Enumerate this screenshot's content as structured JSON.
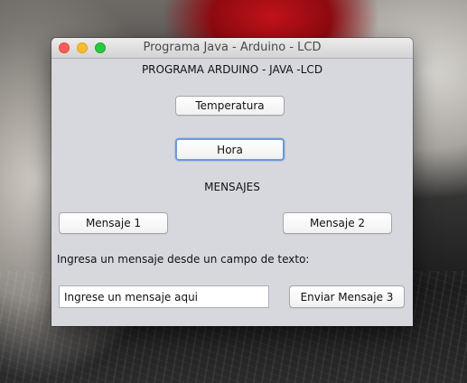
{
  "window": {
    "title": "Programa Java - Arduino - LCD"
  },
  "header": {
    "title": "PROGRAMA ARDUINO - JAVA -LCD"
  },
  "buttons": {
    "temperatura": "Temperatura",
    "hora": "Hora",
    "mensaje1": "Mensaje 1",
    "mensaje2": "Mensaje 2",
    "enviar3": "Enviar Mensaje 3"
  },
  "section": {
    "mensajes": "MENSAJES"
  },
  "input": {
    "label": "Ingresa un mensaje  desde un campo de texto:",
    "value": "Ingrese un mensaje aqui"
  }
}
